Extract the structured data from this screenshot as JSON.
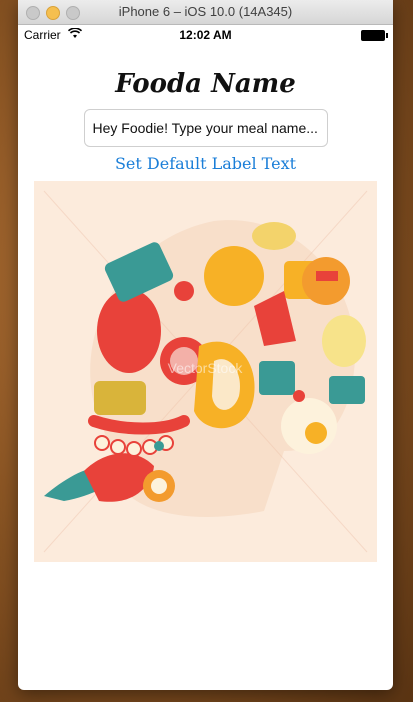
{
  "window": {
    "title": "iPhone 6 – iOS 10.0 (14A345)"
  },
  "status_bar": {
    "carrier": "Carrier",
    "time": "12:02 AM"
  },
  "meal": {
    "title": "Fooda Name",
    "input_placeholder": "Hey Foodie! Type your meal name...",
    "default_button_label": "Set Default Label Text"
  },
  "photo": {
    "watermark": "VectorStock"
  }
}
